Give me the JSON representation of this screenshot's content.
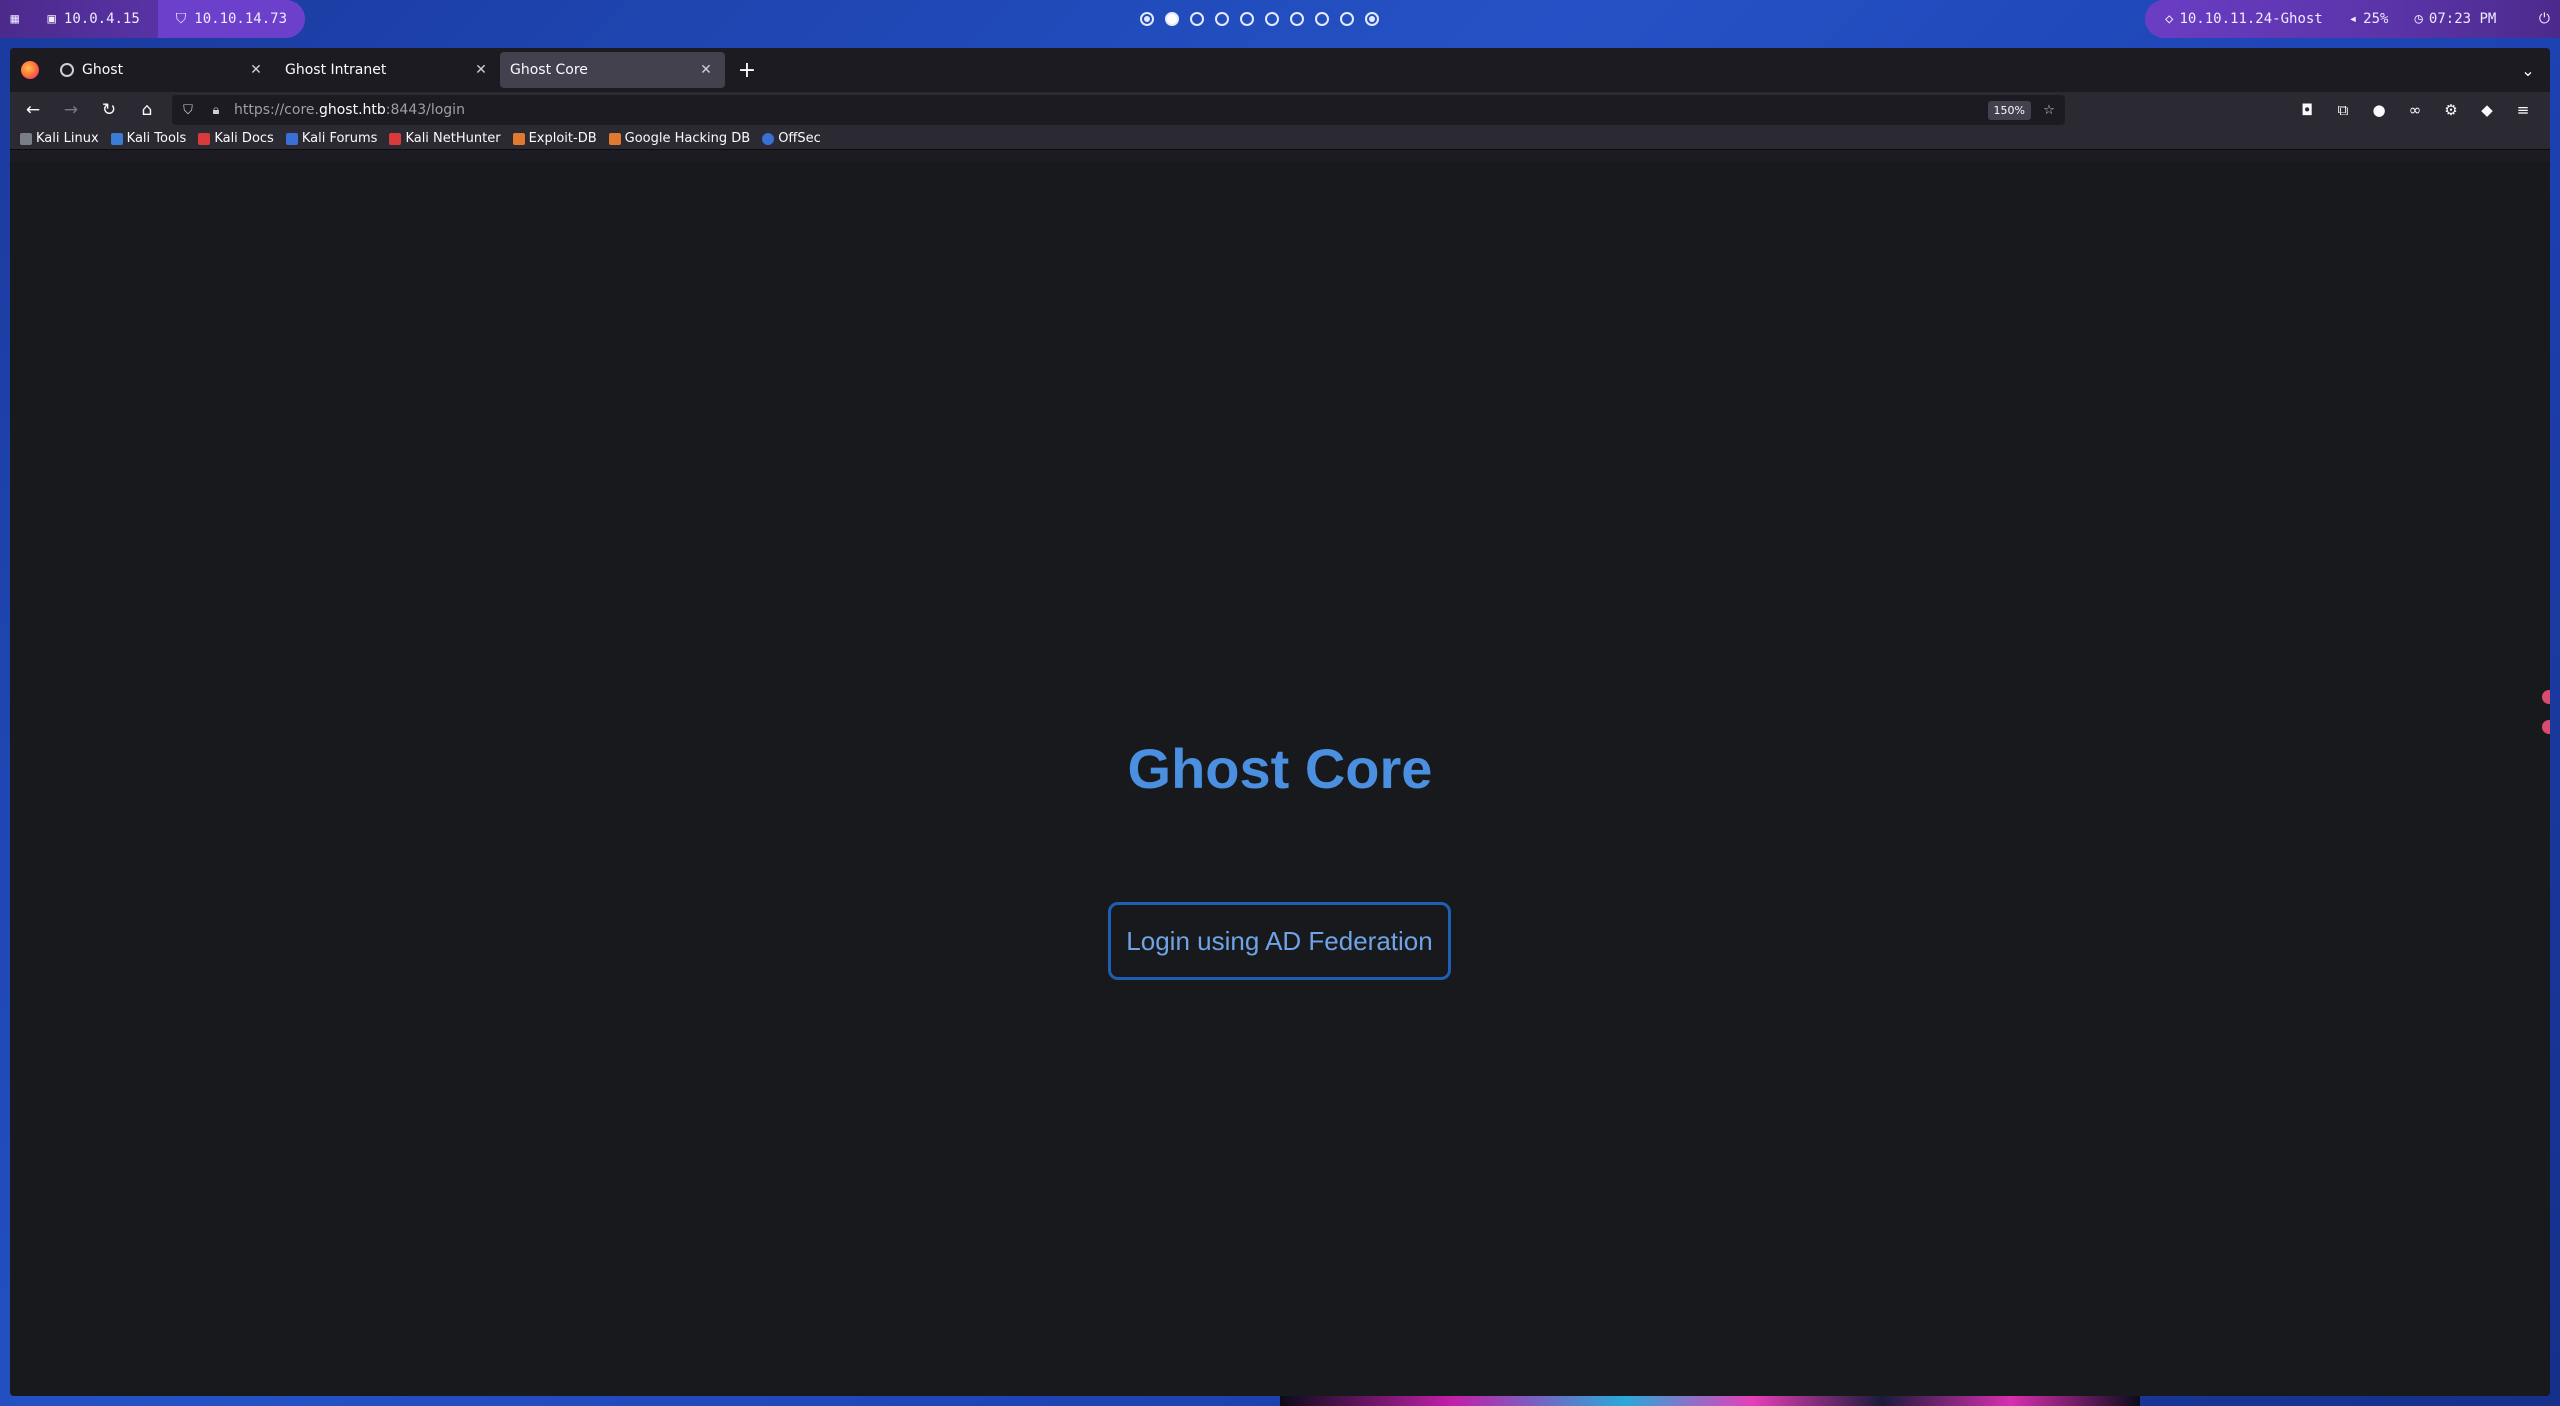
{
  "system_bar": {
    "ip_local": "10.0.4.15",
    "ip_vpn": "10.10.14.73",
    "target": "10.10.11.24-Ghost",
    "volume": "25%",
    "time": "07:23 PM",
    "workspaces": [
      "ring",
      "active",
      "empty",
      "empty",
      "empty",
      "empty",
      "empty",
      "empty",
      "empty",
      "ring"
    ]
  },
  "browser": {
    "tabs": [
      {
        "title": "Ghost",
        "selected": false
      },
      {
        "title": "Ghost Intranet",
        "selected": false
      },
      {
        "title": "Ghost Core",
        "selected": true
      }
    ],
    "url": {
      "prefix": "https://core.",
      "host": "ghost.htb",
      "suffix": ":8443/login"
    },
    "zoom": "150%",
    "bookmarks": [
      {
        "label": "Kali Linux",
        "color": "#7a7f87"
      },
      {
        "label": "Kali Tools",
        "color": "#3a7bd5"
      },
      {
        "label": "Kali Docs",
        "color": "#d93a3a"
      },
      {
        "label": "Kali Forums",
        "color": "#3a6fd5"
      },
      {
        "label": "Kali NetHunter",
        "color": "#d93a3a"
      },
      {
        "label": "Exploit-DB",
        "color": "#e07a2e"
      },
      {
        "label": "Google Hacking DB",
        "color": "#e07a2e"
      },
      {
        "label": "OffSec",
        "color": "#3a6fd5"
      }
    ]
  },
  "page": {
    "title": "Ghost Core",
    "login_button": "Login using AD Federation"
  },
  "colors": {
    "accent": "#4a8fe0",
    "button_border": "#1f5fb3",
    "page_bg": "#18191c"
  }
}
